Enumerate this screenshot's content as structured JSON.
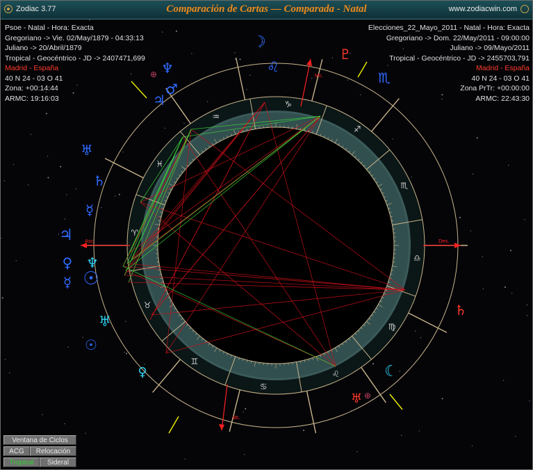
{
  "window": {
    "app_name": "Zodiac 3.77",
    "title": "Comparación de Cartas — Comparada - Natal",
    "url": "www.zodiacwin.com"
  },
  "info_left": [
    {
      "text": "Psoe - Natal - Hora: Exacta",
      "color": "white"
    },
    {
      "text": "Gregoriano -> Vie. 02/May/1879 - 04:33:13",
      "color": "white"
    },
    {
      "text": "Juliano -> 20/Abril/1879",
      "color": "white"
    },
    {
      "text": "Tropical - Geocéntrico - JD -> 2407471,699",
      "color": "white"
    },
    {
      "text": "Madrid - España",
      "color": "red"
    },
    {
      "text": "40 N 24 - 03 O 41",
      "color": "white"
    },
    {
      "text": "Zona: +00:14:44",
      "color": "white"
    },
    {
      "text": "ARMC: 19:16:03",
      "color": "white"
    }
  ],
  "info_right": [
    {
      "text": "Elecciones_22_Mayo_2011 - Natal - Hora: Exacta",
      "color": "white"
    },
    {
      "text": "Gregoriano -> Dom. 22/May/2011 - 09:00:00",
      "color": "white"
    },
    {
      "text": "Juliano -> 09/Mayo/2011",
      "color": "white"
    },
    {
      "text": "Tropical - Geocéntrico - JD -> 2455703,791",
      "color": "white"
    },
    {
      "text": "Madrid - España",
      "color": "red"
    },
    {
      "text": "40 N 24 - 03 O 41",
      "color": "white"
    },
    {
      "text": "Zona PrTr: +00:00:00",
      "color": "white"
    },
    {
      "text": "ARMC: 22:43:30",
      "color": "white"
    }
  ],
  "axis_labels": {
    "asc": "Asc.",
    "des": "Des.",
    "mc": "Mc.",
    "bc": "Bc."
  },
  "zodiac_signs": [
    {
      "name": "aries",
      "glyph": "♈"
    },
    {
      "name": "taurus",
      "glyph": "♉"
    },
    {
      "name": "gemini",
      "glyph": "♊"
    },
    {
      "name": "cancer",
      "glyph": "♋"
    },
    {
      "name": "leo",
      "glyph": "♌"
    },
    {
      "name": "virgo",
      "glyph": "♍"
    },
    {
      "name": "libra",
      "glyph": "♎"
    },
    {
      "name": "scorpio",
      "glyph": "♏"
    },
    {
      "name": "sagittarius",
      "glyph": "♐"
    },
    {
      "name": "capricorn",
      "glyph": "♑"
    },
    {
      "name": "aquarius",
      "glyph": "♒"
    },
    {
      "name": "pisces",
      "glyph": "♓"
    }
  ],
  "outer_planets": [
    {
      "name": "moon",
      "glyph": "☽",
      "color": "#2f6bff"
    },
    {
      "name": "leo-sign",
      "glyph": "♌",
      "color": "#2f6bff"
    },
    {
      "name": "scorpio-sign",
      "glyph": "♏",
      "color": "#2f6bff"
    },
    {
      "name": "mars",
      "glyph": "♂",
      "color": "#2f6bff"
    },
    {
      "name": "jupiter",
      "glyph": "♃",
      "color": "#2f6bff"
    },
    {
      "name": "neptune",
      "glyph": "♆",
      "color": "#2f6bff"
    },
    {
      "name": "part-of-fortune",
      "glyph": "⊕",
      "color": "#c04060"
    },
    {
      "name": "uranus",
      "glyph": "♅",
      "color": "#2f6bff"
    },
    {
      "name": "saturn",
      "glyph": "♄",
      "color": "#2f6bff"
    },
    {
      "name": "mercury",
      "glyph": "☿",
      "color": "#2f6bff"
    },
    {
      "name": "venus",
      "glyph": "♀",
      "color": "#2f6bff"
    },
    {
      "name": "sun",
      "glyph": "☉",
      "color": "#2f6bff"
    },
    {
      "name": "pluto",
      "glyph": "♇",
      "color": "#ff3a2a"
    }
  ],
  "buttons": {
    "cycles": "Ventana de Ciclos",
    "acg": "ACG",
    "relocation": "Relocación",
    "tropical": "Tropical",
    "sidereal": "Sideral"
  },
  "colors": {
    "ring_outer": "#c8b48a",
    "zodiac_band": "#3b5a5a",
    "aspect_red": "#c8101a",
    "aspect_green": "#3ad43a",
    "outer_glyph": "#2f6bff",
    "transit_glyph": "#2fd0f0",
    "axis_red": "#ff2020",
    "title": "#f08a1a"
  }
}
